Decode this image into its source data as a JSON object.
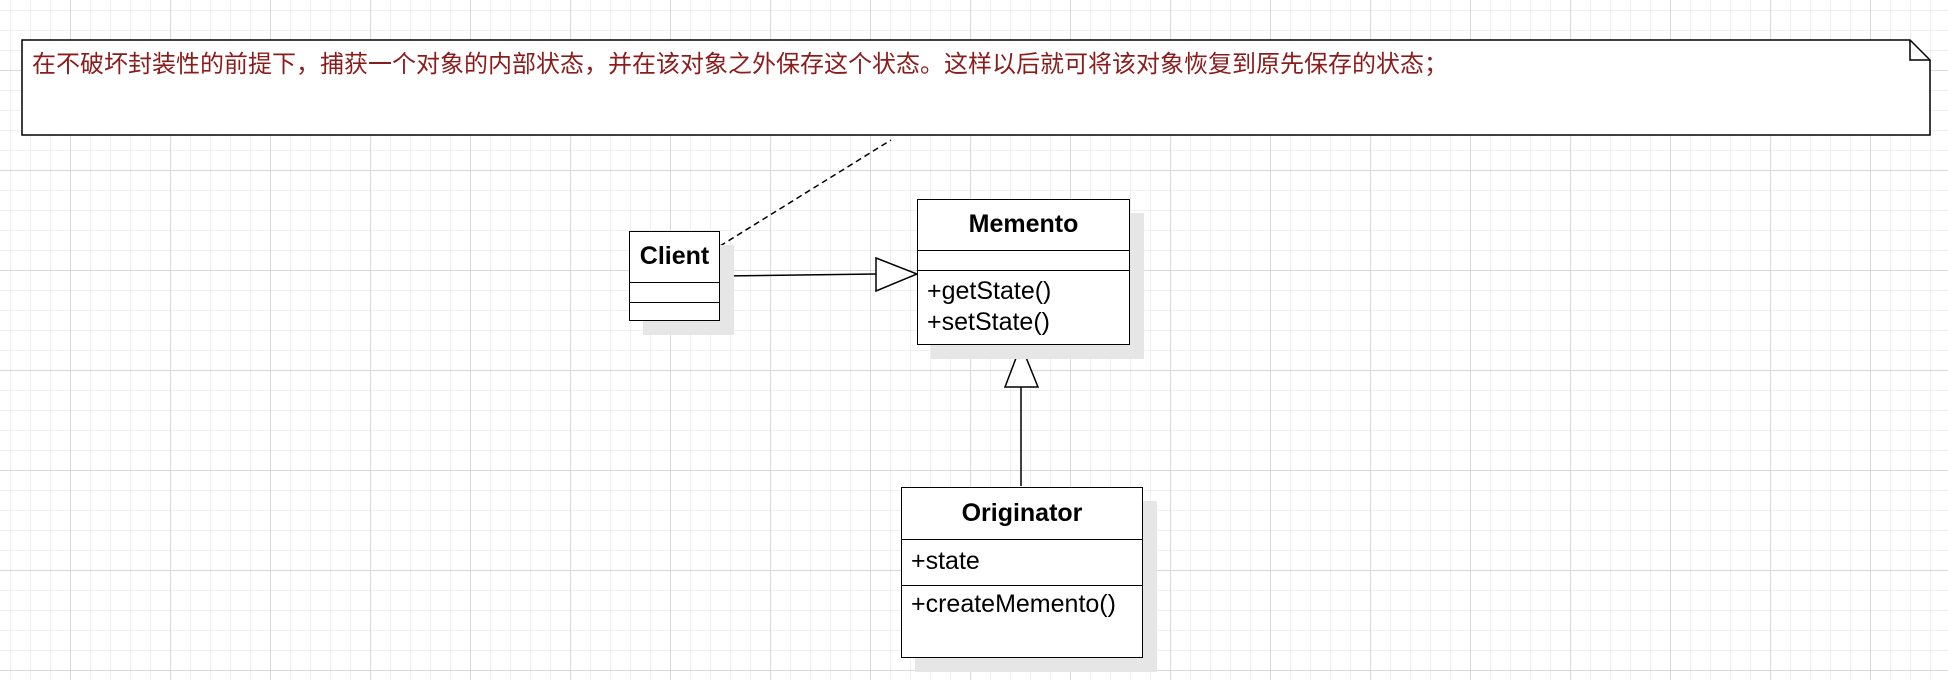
{
  "note": {
    "text": "在不破坏封装性的前提下，捕获一个对象的内部状态，并在该对象之外保存这个状态。这样以后就可将该对象恢复到原先保存的状态；"
  },
  "classes": {
    "client": {
      "name": "Client",
      "attributes": [],
      "methods": []
    },
    "memento": {
      "name": "Memento",
      "attributes": [],
      "methods": [
        "+getState()",
        "+setState()"
      ]
    },
    "originator": {
      "name": "Originator",
      "attributes": [
        "+state"
      ],
      "methods": [
        "+createMemento()"
      ]
    }
  },
  "relations": [
    {
      "from": "Client",
      "to": "Memento",
      "type": "generalization"
    },
    {
      "from": "Originator",
      "to": "Memento",
      "type": "generalization"
    },
    {
      "from": "Client",
      "to": "note",
      "type": "note-anchor",
      "style": "dashed"
    }
  ],
  "colors": {
    "note_text": "#8b1c1c",
    "grid_major": "#d8d8d8",
    "grid_minor": "#efefef"
  }
}
